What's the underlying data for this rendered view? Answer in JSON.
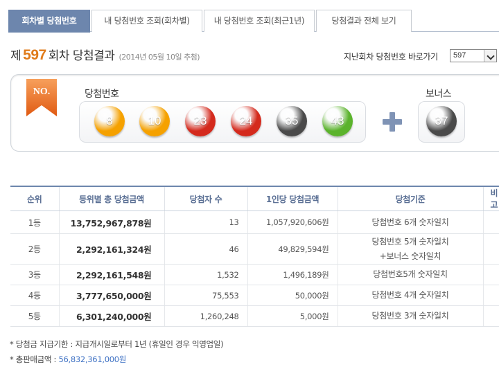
{
  "tabs": [
    {
      "label": "회차별 당첨번호",
      "active": true
    },
    {
      "label": "내 당첨번호 조회(회차별)",
      "active": false
    },
    {
      "label": "내 당첨번호 조회(최근1년)",
      "active": false
    },
    {
      "label": "당첨결과 전체 보기",
      "active": false
    }
  ],
  "header": {
    "prefix": "제",
    "round": "597",
    "suffix": "회차 당첨결과",
    "draw_date": "(2014년 05월 10일 추첨)",
    "goto_label": "지난회차 당첨번호 바로가기",
    "goto_value": "597"
  },
  "draw": {
    "ribbon_text": "NO.",
    "winning_label": "당첨번호",
    "bonus_label": "보너스",
    "numbers": [
      {
        "value": "8",
        "color": "#f5a100"
      },
      {
        "value": "10",
        "color": "#f5a100"
      },
      {
        "value": "23",
        "color": "#d42a1d"
      },
      {
        "value": "24",
        "color": "#d42a1d"
      },
      {
        "value": "35",
        "color": "#4a4a4a"
      },
      {
        "value": "43",
        "color": "#5bb32c"
      }
    ],
    "bonus": {
      "value": "37",
      "color": "#4a4a4a"
    }
  },
  "table": {
    "headers": [
      "순위",
      "등위별 총 당첨금액",
      "당첨자 수",
      "1인당 당첨금액",
      "당첨기준",
      "비고"
    ],
    "rows": [
      {
        "rank": "1등",
        "total": "13,752,967,878원",
        "winners": "13",
        "per": "1,057,920,606원",
        "crit1": "당첨번호 6개 숫자일치",
        "crit2": ""
      },
      {
        "rank": "2등",
        "total": "2,292,161,324원",
        "winners": "46",
        "per": "49,829,594원",
        "crit1": "당첨번호 5개 숫자일치",
        "crit2": "+보너스 숫자일치"
      },
      {
        "rank": "3등",
        "total": "2,292,161,548원",
        "winners": "1,532",
        "per": "1,496,189원",
        "crit1": "당첨번호5개 숫자일치",
        "crit2": ""
      },
      {
        "rank": "4등",
        "total": "3,777,650,000원",
        "winners": "75,553",
        "per": "50,000원",
        "crit1": "당첨번호 4개 숫자일치",
        "crit2": ""
      },
      {
        "rank": "5등",
        "total": "6,301,240,000원",
        "winners": "1,260,248",
        "per": "5,000원",
        "crit1": "당첨번호 3개 숫자일치",
        "crit2": ""
      }
    ]
  },
  "footer": {
    "line1": "* 당첨금 지급기한 : 지급개시일로부터 1년 (휴일인 경우 익영업일)",
    "line2_label": "* 총판매금액 : ",
    "line2_value": "56,832,361,000원"
  }
}
